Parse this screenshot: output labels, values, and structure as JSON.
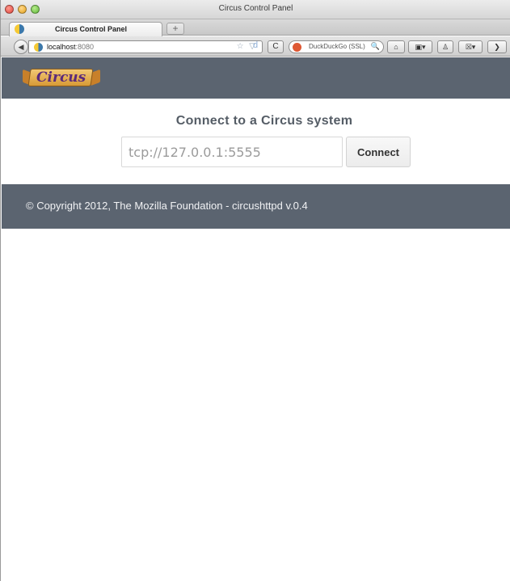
{
  "window": {
    "title": "Circus Control Panel"
  },
  "tabs": [
    {
      "label": "Circus Control Panel"
    }
  ],
  "tabstrip": {
    "new_tab_label": "+"
  },
  "navbar": {
    "back_glyph": "◀",
    "url_host": "localhost",
    "url_port": ":8080",
    "url_icons": "☆ ▽",
    "ddg_letter": "d",
    "reload_glyph": "C",
    "search_placeholder": "DuckDuckGo (SSL)",
    "search_glyph": "🔍",
    "home_glyph": "⌂",
    "tool1_glyph": "▣▾",
    "tool2_glyph": "♙",
    "tool3_glyph": "☒▾",
    "more_glyph": "❯"
  },
  "site": {
    "logo_text": "Circus",
    "connect_title": "Connect to a Circus system",
    "endpoint_placeholder": "tcp://127.0.0.1:5555",
    "connect_label": "Connect",
    "footer": "© Copyright 2012, The Mozilla Foundation - circushttpd v.0.4"
  },
  "colors": {
    "header_bg": "#5b6470",
    "footer_bg": "#5b6470",
    "title_text": "#555d66"
  }
}
